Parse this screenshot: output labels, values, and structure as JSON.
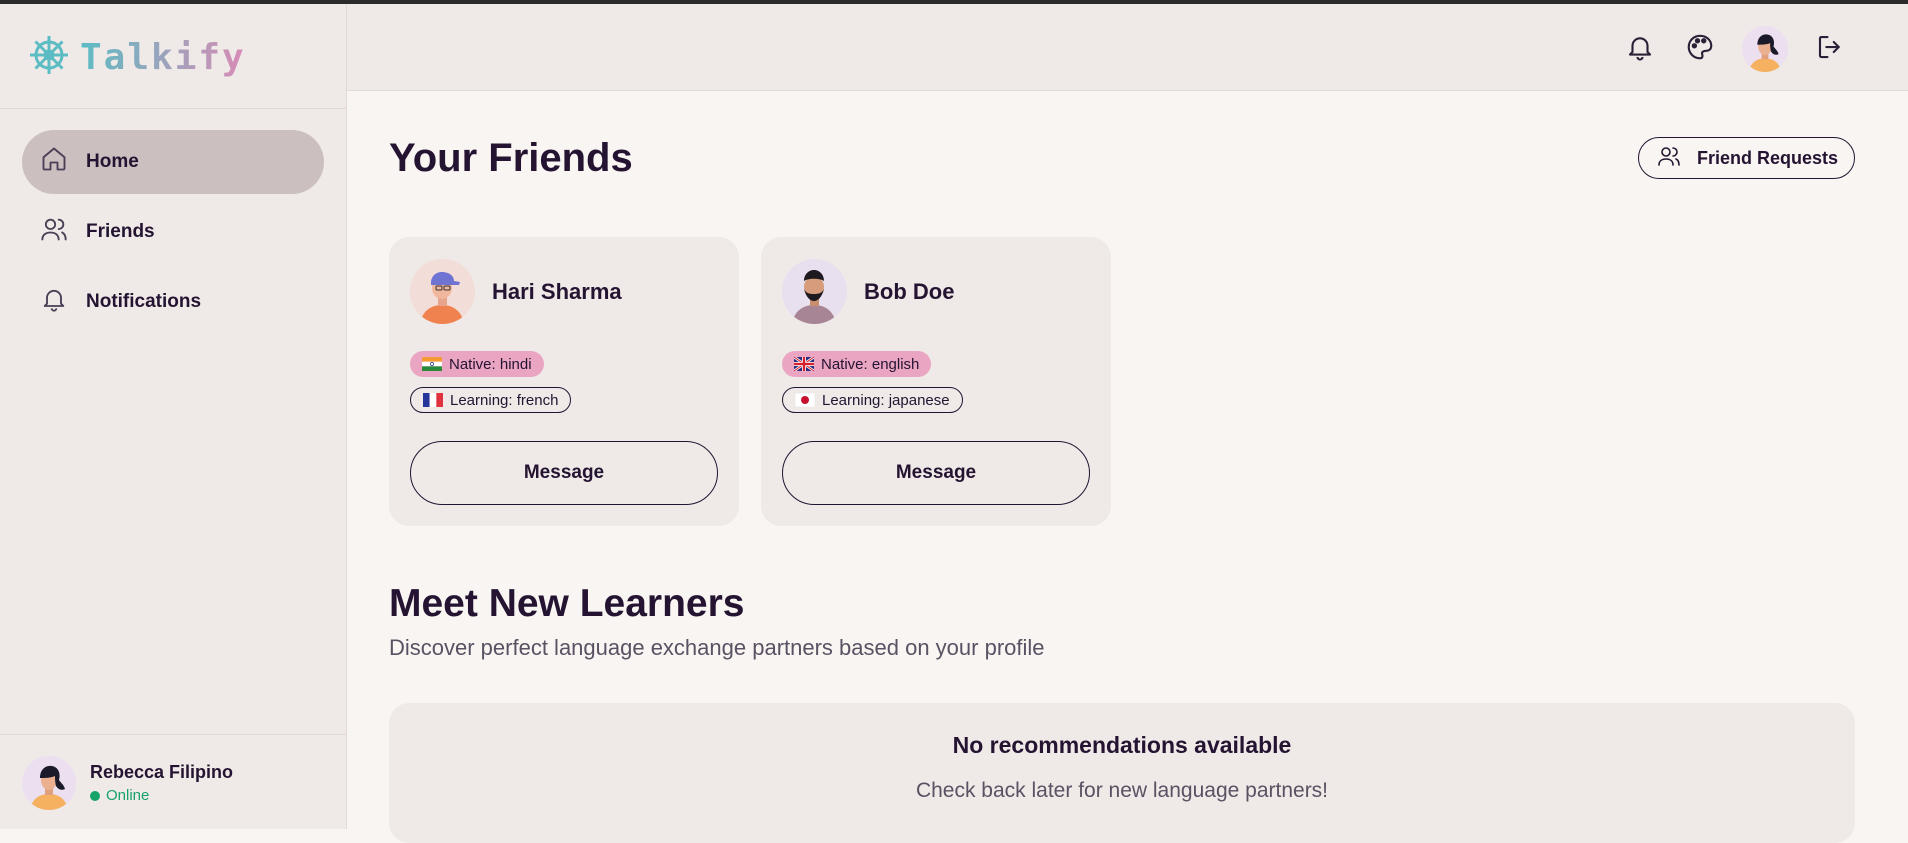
{
  "app": {
    "name": "Talkify"
  },
  "sidebar": {
    "items": [
      {
        "label": "Home",
        "icon": "home-icon",
        "active": true
      },
      {
        "label": "Friends",
        "icon": "users-icon",
        "active": false
      },
      {
        "label": "Notifications",
        "icon": "bell-icon",
        "active": false
      }
    ],
    "user": {
      "name": "Rebecca Filipino",
      "status": "Online"
    }
  },
  "header": {
    "icons": [
      "bell-icon",
      "palette-icon",
      "avatar",
      "logout-icon"
    ]
  },
  "main": {
    "title": "Your Friends",
    "friend_requests_label": "Friend Requests",
    "friends": [
      {
        "name": "Hari Sharma",
        "native": "Native: hindi",
        "learning": "Learning: french",
        "message_label": "Message"
      },
      {
        "name": "Bob Doe",
        "native": "Native: english",
        "learning": "Learning: japanese",
        "message_label": "Message"
      }
    ],
    "recommend": {
      "title": "Meet New Learners",
      "subtitle": "Discover perfect language exchange partners based on your profile",
      "empty_title": "No recommendations available",
      "empty_text": "Check back later for new language partners!"
    }
  },
  "colors": {
    "accent_pink": "#eaa5c3",
    "online_green": "#16a36a",
    "active_nav": "#cbbfc0",
    "logo_teal": "#5cbcc4"
  }
}
